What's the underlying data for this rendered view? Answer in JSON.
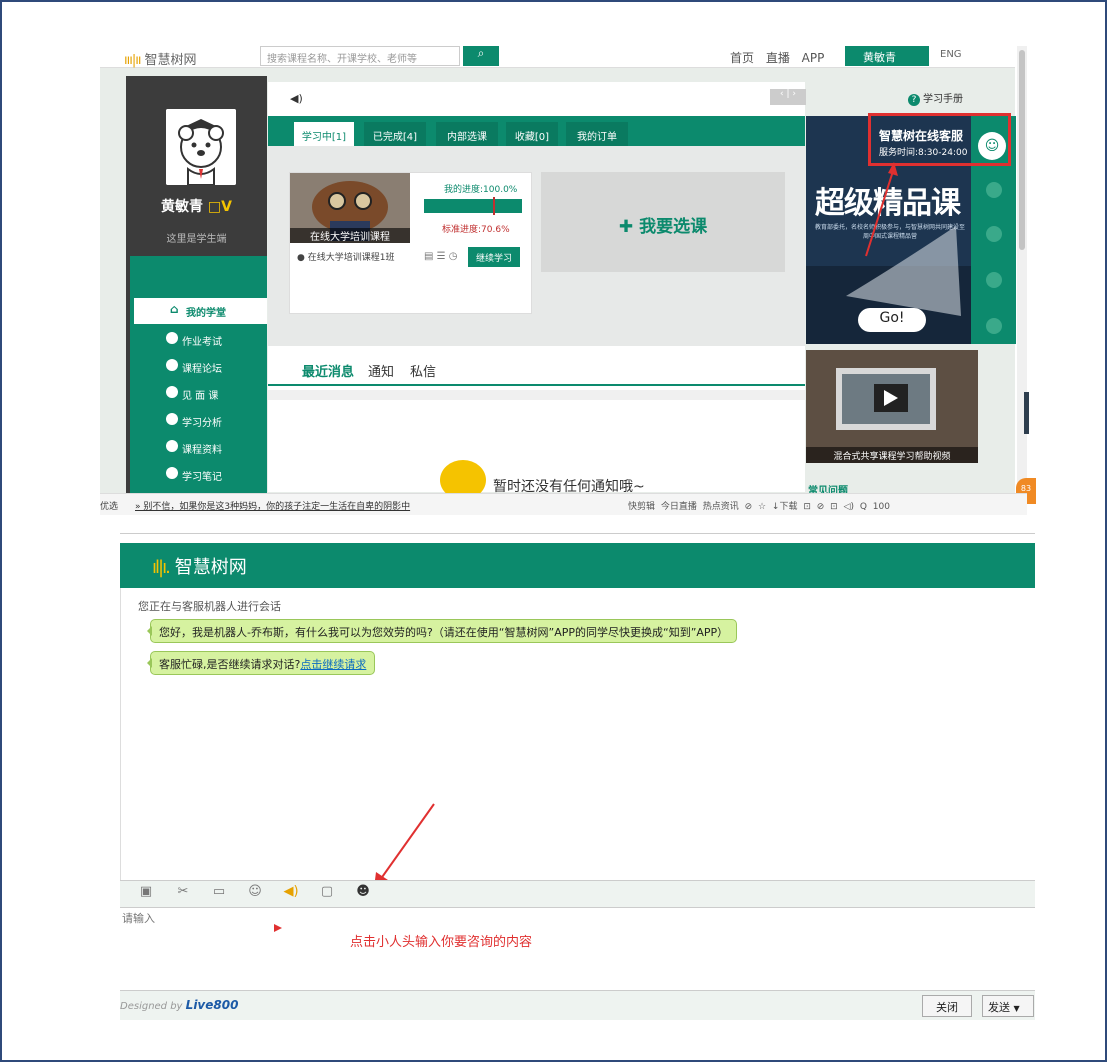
{
  "top_nav": {
    "search_placeholder": "搜索课程名称、开课学校、老师等",
    "links": "首页 直播 APP",
    "user": "黄敏青",
    "lang": "ENG"
  },
  "profile": {
    "name": "黄敏青",
    "badge": "□V",
    "role": "这里是学生端"
  },
  "menu": [
    {
      "label": "我的学堂",
      "active": true
    },
    {
      "label": "作业考试"
    },
    {
      "label": "课程论坛"
    },
    {
      "label": "见 面 课"
    },
    {
      "label": "学习分析"
    },
    {
      "label": "课程资料"
    },
    {
      "label": "学习笔记"
    }
  ],
  "header": {
    "sound": "◀)",
    "help": "学习手册"
  },
  "tabs": [
    "学习中[1]",
    "已完成[4]",
    "内部选课",
    "收藏[0]",
    "我的订单"
  ],
  "course": {
    "image_label": "在线大学培训课程",
    "class_name": "在线大学培训课程1班",
    "my_progress": "我的进度:100.0%",
    "standard_progress": "标准进度:70.6%",
    "continue": "继续学习",
    "progress_value": 1.0,
    "standard_value": 0.706
  },
  "add_course": "我要选课",
  "news_tabs": [
    "最近消息",
    "通知",
    "私信"
  ],
  "empty_text": "暂时还没有任何通知哦~",
  "promo": {
    "title": "超级精品课",
    "subtitle": "教育部委托，名校名师积极参与，与智慧树网共同建设至周中国式课程精品营",
    "go": "Go!",
    "video_caption": "混合式共享课程学习帮助视频",
    "faq": "常见问题"
  },
  "customer_service": {
    "title": "智慧树在线客服",
    "time": "服务时间:8:30-24:00"
  },
  "browser_status": {
    "left": "优选",
    "news": "» 别不信，如果你是这3种妈妈，你的孩子注定一生活在自卑的阴影中",
    "tools": "快剪辑  今日直播  热点资讯  ⊘  ☆  ↓下载  ⊡  ⊘  ⊡  ◁)  Q 100",
    "badge": "83"
  },
  "chat": {
    "logo": "智慧树网",
    "status": "您正在与客服机器人进行会话",
    "messages": [
      {
        "text": "您好，我是机器人-乔布斯，有什么我可以为您效劳的吗?（请还在使用“智慧树网”APP的同学尽快更换成“知到”APP）"
      },
      {
        "text": "客服忙碌,是否继续请求对话?",
        "link": "点击继续请求"
      }
    ],
    "input_placeholder": "请输入",
    "hint": "点击小人头输入你要咨询的内容",
    "designed_by": "Designed by",
    "brand": "Live800",
    "close": "关闭",
    "send": "发送"
  }
}
